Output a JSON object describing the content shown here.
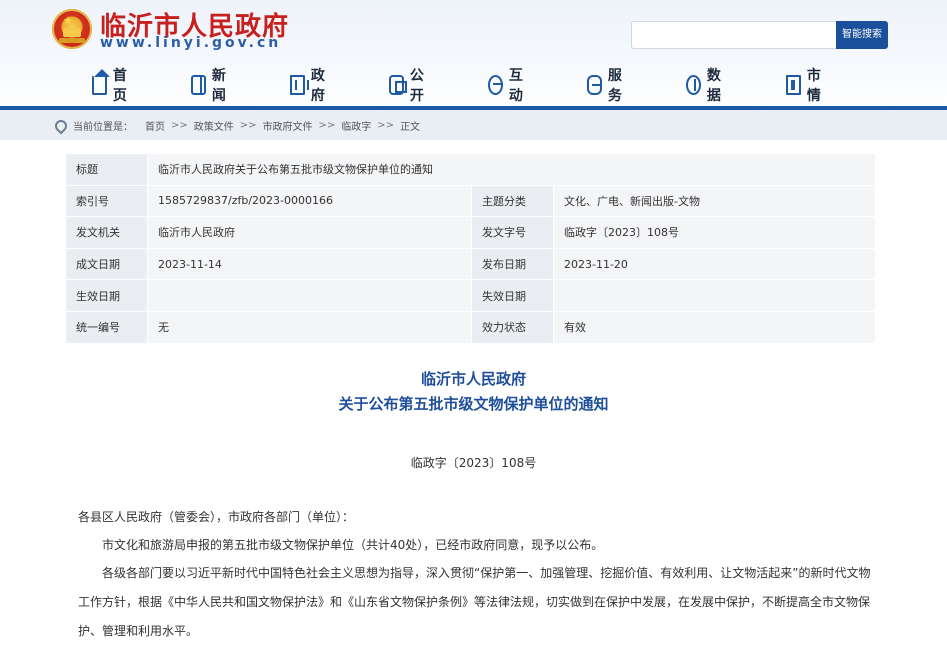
{
  "header": {
    "site_title": "临沂市人民政府",
    "site_url": "www.linyi.gov.cn",
    "search_button": "智能搜索",
    "search_placeholder": ""
  },
  "nav": [
    {
      "label": "首页",
      "icon": "home-icon"
    },
    {
      "label": "新闻",
      "icon": "news-icon"
    },
    {
      "label": "政府",
      "icon": "government-icon"
    },
    {
      "label": "公开",
      "icon": "open-icon"
    },
    {
      "label": "互动",
      "icon": "interaction-icon"
    },
    {
      "label": "服务",
      "icon": "service-icon"
    },
    {
      "label": "数据",
      "icon": "data-icon"
    },
    {
      "label": "市情",
      "icon": "city-icon"
    }
  ],
  "breadcrumb": {
    "prefix": "当前位置是：",
    "items": [
      "首页",
      "政策文件",
      "市政府文件",
      "临政字",
      "正文"
    ],
    "separator": ">>"
  },
  "info": {
    "title_label": "标题",
    "title_value": "临沂市人民政府关于公布第五批市级文物保护单位的通知",
    "rows": [
      {
        "l1": "索引号",
        "v1": "1585729837/zfb/2023-0000166",
        "l2": "主题分类",
        "v2": "文化、广电、新闻出版-文物"
      },
      {
        "l1": "发文机关",
        "v1": "临沂市人民政府",
        "l2": "发文字号",
        "v2": "临政字〔2023〕108号"
      },
      {
        "l1": "成文日期",
        "v1": "2023-11-14",
        "l2": "发布日期",
        "v2": "2023-11-20"
      },
      {
        "l1": "生效日期",
        "v1": "",
        "l2": "失效日期",
        "v2": ""
      },
      {
        "l1": "统一编号",
        "v1": "无",
        "l2": "效力状态",
        "v2": "有效"
      }
    ]
  },
  "document": {
    "title_line1": "临沂市人民政府",
    "title_line2": "关于公布第五批市级文物保护单位的通知",
    "doc_number": "临政字〔2023〕108号",
    "salutation": "各县区人民政府（管委会），市政府各部门（单位）：",
    "para1": "市文化和旅游局申报的第五批市级文物保护单位（共计40处），已经市政府同意，现予以公布。",
    "para2": "各级各部门要以习近平新时代中国特色社会主义思想为指导，深入贯彻“保护第一、加强管理、挖掘价值、有效利用、让文物活起来”的新时代文物工作方针，根据《中华人民共和国文物保护法》和《山东省文物保护条例》等法律法规，切实做到在保护中发展，在发展中保护，不断提高全市文物保护、管理和利用水平。"
  },
  "colors": {
    "brand_red": "#c8201e",
    "nav_blue": "#1d56a4",
    "title_blue": "#1f4f9a"
  }
}
